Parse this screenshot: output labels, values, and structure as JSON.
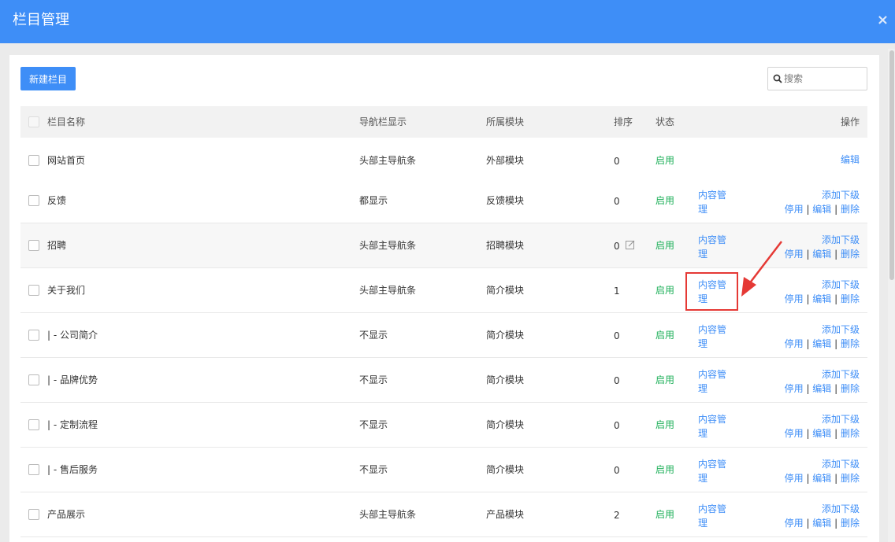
{
  "window": {
    "title": "栏目管理",
    "close_label": "×"
  },
  "toolbar": {
    "new_button": "新建栏目",
    "search_placeholder": "搜索"
  },
  "table": {
    "headers": {
      "name": "栏目名称",
      "nav": "导航栏显示",
      "module": "所属模块",
      "order": "排序",
      "status": "状态",
      "actions": "操作"
    },
    "rows": [
      {
        "name": "网站首页",
        "nav": "头部主导航条",
        "module": "外部模块",
        "order": "0",
        "status": "启用",
        "content_line1": "",
        "content_line2": "",
        "ops_line1": "",
        "ops_stop": "",
        "ops_edit": "编辑",
        "ops_delete": ""
      },
      {
        "name": "反馈",
        "nav": "都显示",
        "module": "反馈模块",
        "order": "0",
        "status": "启用",
        "content_line1": "内容管",
        "content_line2": "理",
        "ops_line1": "添加下级",
        "ops_stop": "停用",
        "ops_edit": "编辑",
        "ops_delete": "删除"
      },
      {
        "name": "招聘",
        "nav": "头部主导航条",
        "module": "招聘模块",
        "order": "0",
        "status": "启用",
        "content_line1": "内容管",
        "content_line2": "理",
        "ops_line1": "添加下级",
        "ops_stop": "停用",
        "ops_edit": "编辑",
        "ops_delete": "删除"
      },
      {
        "name": "关于我们",
        "nav": "头部主导航条",
        "module": "简介模块",
        "order": "1",
        "status": "启用",
        "content_line1": "内容管",
        "content_line2": "理",
        "ops_line1": "添加下级",
        "ops_stop": "停用",
        "ops_edit": "编辑",
        "ops_delete": "删除"
      },
      {
        "name": "| - 公司简介",
        "nav": "不显示",
        "module": "简介模块",
        "order": "0",
        "status": "启用",
        "content_line1": "内容管",
        "content_line2": "理",
        "ops_line1": "添加下级",
        "ops_stop": "停用",
        "ops_edit": "编辑",
        "ops_delete": "删除"
      },
      {
        "name": "| - 品牌优势",
        "nav": "不显示",
        "module": "简介模块",
        "order": "0",
        "status": "启用",
        "content_line1": "内容管",
        "content_line2": "理",
        "ops_line1": "添加下级",
        "ops_stop": "停用",
        "ops_edit": "编辑",
        "ops_delete": "删除"
      },
      {
        "name": "| - 定制流程",
        "nav": "不显示",
        "module": "简介模块",
        "order": "0",
        "status": "启用",
        "content_line1": "内容管",
        "content_line2": "理",
        "ops_line1": "添加下级",
        "ops_stop": "停用",
        "ops_edit": "编辑",
        "ops_delete": "删除"
      },
      {
        "name": "| - 售后服务",
        "nav": "不显示",
        "module": "简介模块",
        "order": "0",
        "status": "启用",
        "content_line1": "内容管",
        "content_line2": "理",
        "ops_line1": "添加下级",
        "ops_stop": "停用",
        "ops_edit": "编辑",
        "ops_delete": "删除"
      },
      {
        "name": "产品展示",
        "nav": "头部主导航条",
        "module": "产品模块",
        "order": "2",
        "status": "启用",
        "content_line1": "内容管",
        "content_line2": "理",
        "ops_line1": "添加下级",
        "ops_stop": "停用",
        "ops_edit": "编辑",
        "ops_delete": "删除"
      }
    ]
  },
  "colors": {
    "primary": "#3e8ef7",
    "status_green": "#1fb05a",
    "highlight_red": "#e53935"
  }
}
